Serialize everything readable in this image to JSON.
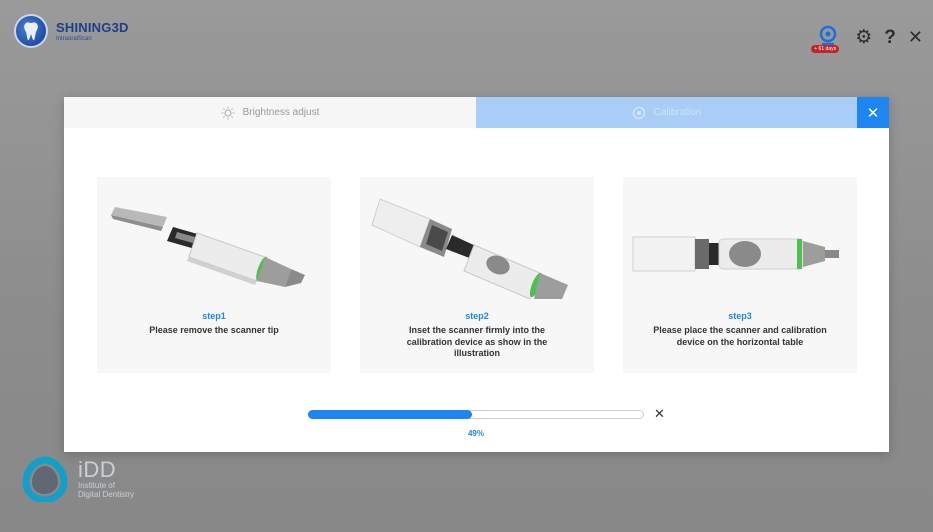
{
  "app": {
    "brand": "SHINING3D",
    "brand_sub": "IntraoralScan",
    "device_badge": "+ 61 days"
  },
  "watermark": {
    "title": "iDD",
    "line1": "Institute of",
    "line2": "Digital Dentistry"
  },
  "modal": {
    "tabs": [
      {
        "label": "Brightness adjust",
        "icon": "sun-icon"
      },
      {
        "label": "Calibration",
        "icon": "target-icon"
      }
    ],
    "close_label": "✕",
    "steps": [
      {
        "label": "step1",
        "description": "Please remove the scanner tip"
      },
      {
        "label": "step2",
        "description": "Inset the scanner firmly into the calibration device as show in the illustration"
      },
      {
        "label": "step3",
        "description": "Please place the scanner and calibration device on the horizontal table"
      }
    ],
    "progress": {
      "value": 0.49,
      "text": "49%",
      "cancel_label": "✕"
    }
  },
  "colors": {
    "accent": "#1d86f0",
    "tab_active": "#a8cdf7",
    "badge": "#c0262b",
    "brand": "#1d3f8a"
  }
}
